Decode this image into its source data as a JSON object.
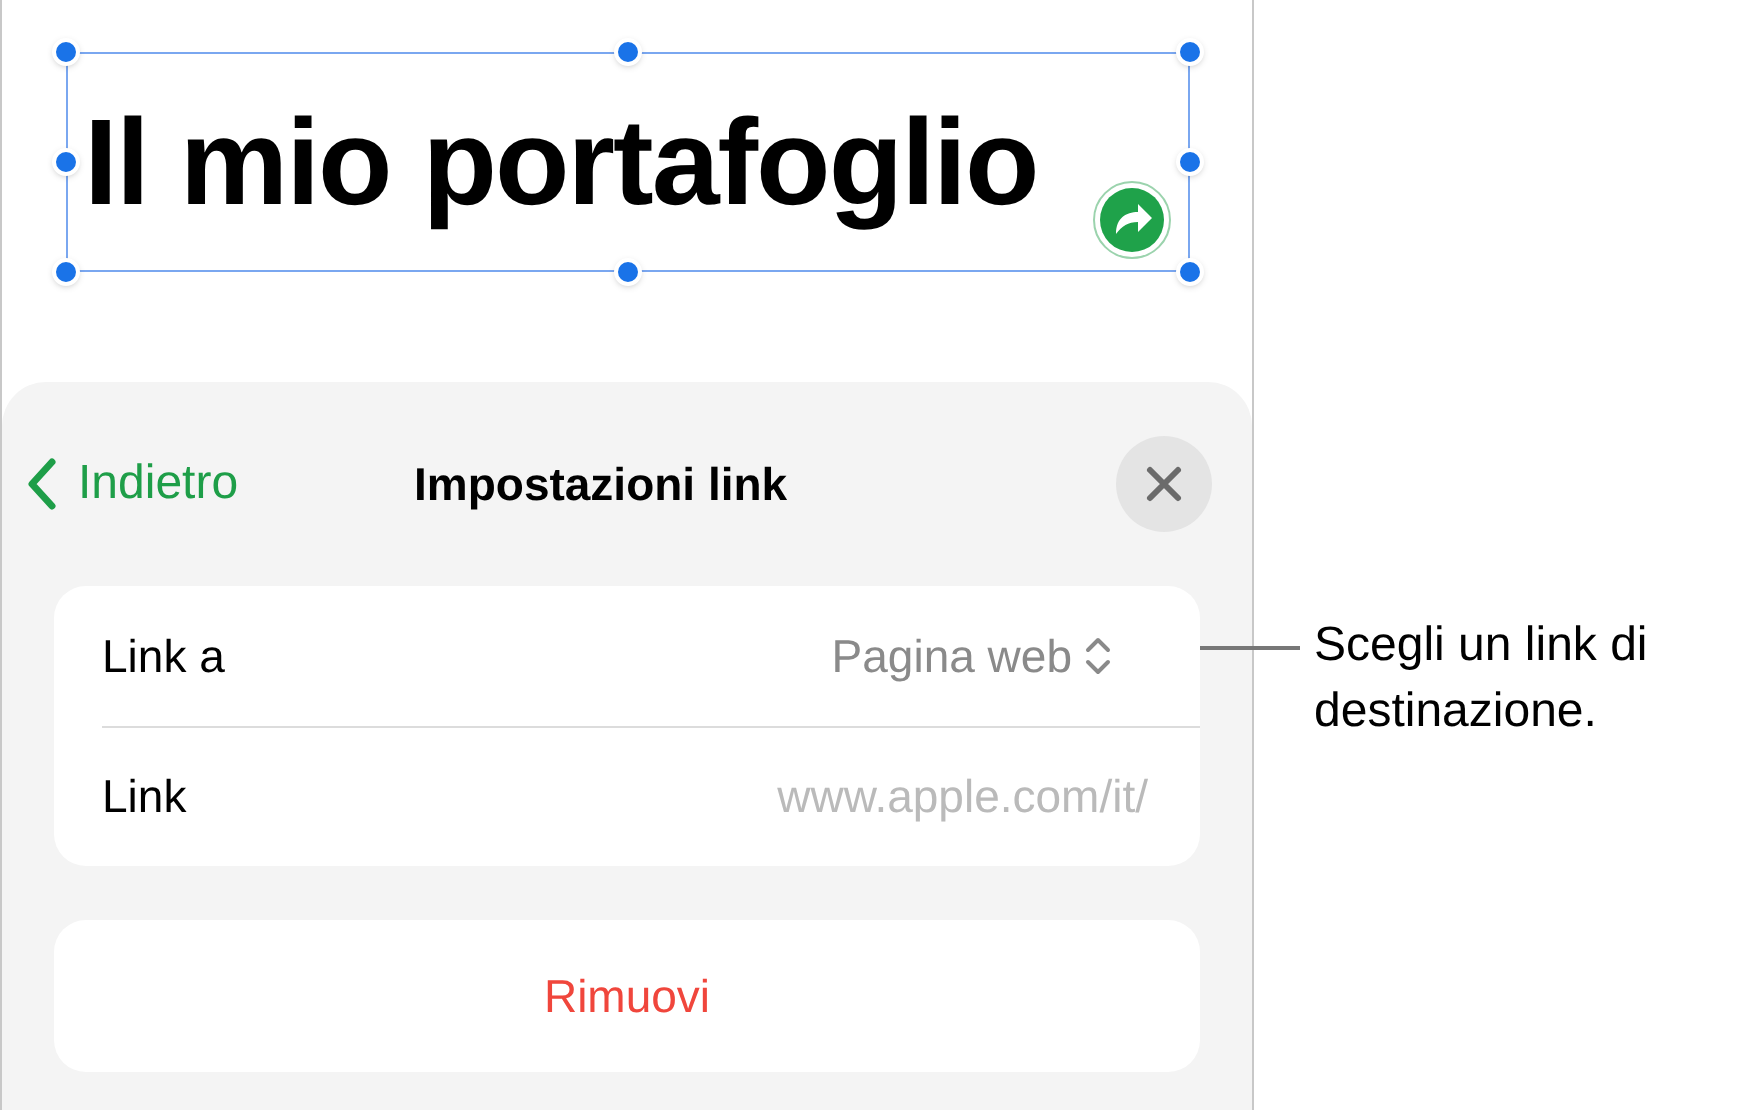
{
  "canvas": {
    "text_box": {
      "text": "Il mio portafoglio",
      "selected": true
    }
  },
  "sheet": {
    "back": {
      "label": "Indietro"
    },
    "title": "Impostazioni link",
    "settings": [
      {
        "kind": "popup",
        "label": "Link a",
        "value": "Pagina web"
      },
      {
        "kind": "text",
        "label": "Link",
        "value": "www.apple.com/it/"
      }
    ],
    "remove_button": "Rimuovi"
  },
  "callout": "Scegli un link di destinazione."
}
